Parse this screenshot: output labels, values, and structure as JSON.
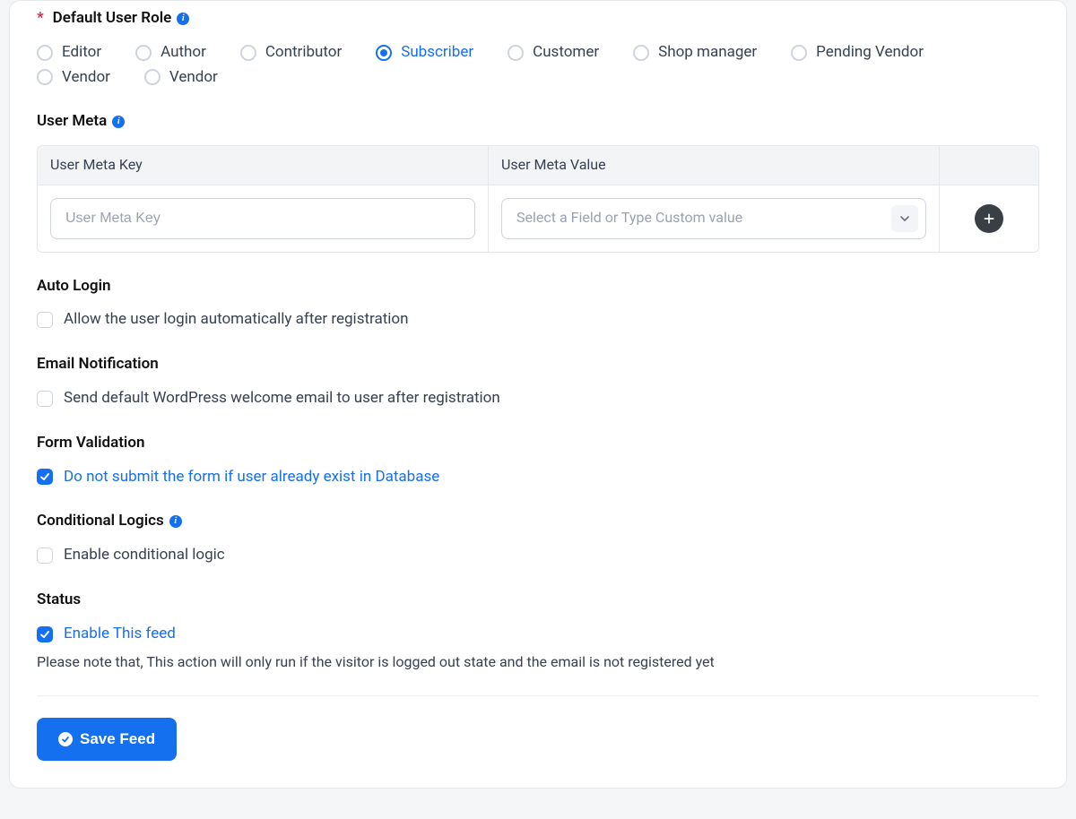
{
  "default_role": {
    "label": "Default User Role",
    "required_mark": "*",
    "options": [
      {
        "label": "Editor",
        "selected": false
      },
      {
        "label": "Author",
        "selected": false
      },
      {
        "label": "Contributor",
        "selected": false
      },
      {
        "label": "Subscriber",
        "selected": true
      },
      {
        "label": "Customer",
        "selected": false
      },
      {
        "label": "Shop manager",
        "selected": false
      },
      {
        "label": "Pending Vendor",
        "selected": false
      },
      {
        "label": "Vendor",
        "selected": false
      },
      {
        "label": "Vendor",
        "selected": false
      }
    ]
  },
  "user_meta": {
    "label": "User Meta",
    "columns": {
      "key": "User Meta Key",
      "value": "User Meta Value"
    },
    "row": {
      "key_placeholder": "User Meta Key",
      "value_placeholder": "Select a Field or Type Custom value"
    }
  },
  "auto_login": {
    "label": "Auto Login",
    "option": "Allow the user login automatically after registration",
    "checked": false
  },
  "email_notification": {
    "label": "Email Notification",
    "option": "Send default WordPress welcome email to user after registration",
    "checked": false
  },
  "form_validation": {
    "label": "Form Validation",
    "option": "Do not submit the form if user already exist in Database",
    "checked": true
  },
  "conditional": {
    "label": "Conditional Logics",
    "option": "Enable conditional logic",
    "checked": false
  },
  "status": {
    "label": "Status",
    "option": "Enable This feed",
    "checked": true,
    "note": "Please note that, This action will only run if the visitor is logged out state and the email is not registered yet"
  },
  "save_label": "Save Feed",
  "info_glyph": "i"
}
